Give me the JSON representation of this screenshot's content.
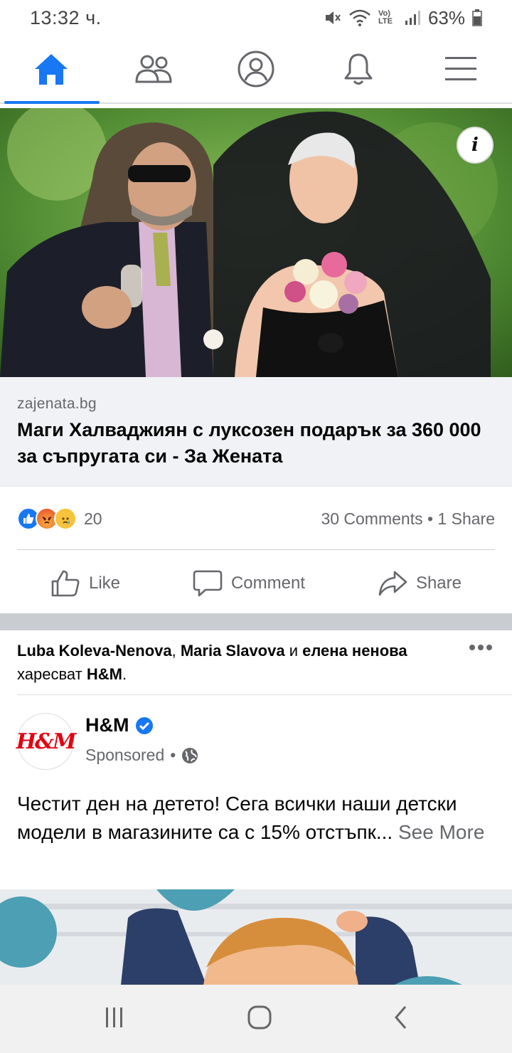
{
  "status_bar": {
    "time": "13:32 ч.",
    "network_label": "Vo) LTE",
    "battery": "63%"
  },
  "nav": {
    "tabs": [
      {
        "icon": "home-icon",
        "active": true
      },
      {
        "icon": "friends-icon",
        "active": false
      },
      {
        "icon": "profile-icon",
        "active": false
      },
      {
        "icon": "notifications-icon",
        "active": false
      },
      {
        "icon": "menu-icon",
        "active": false
      }
    ],
    "accent_color": "#1877f2"
  },
  "post1": {
    "image_icon": "info-icon",
    "info_label": "i",
    "link": {
      "domain": "zajenata.bg",
      "title": "Маги Халваджиян с луксозен подарък за 360 000 за съпругата си - За Жената"
    },
    "reactions": {
      "icons": [
        "like-reaction-icon",
        "angry-reaction-icon",
        "sad-reaction-icon"
      ],
      "count": "20"
    },
    "comments_share": "30 Comments • 1 Share",
    "actions": {
      "like": "Like",
      "comment": "Comment",
      "share": "Share"
    }
  },
  "post2": {
    "social_context": {
      "name1": "Luba Koleva-Nenova",
      "sep1": ", ",
      "name2": "Maria Slavova",
      "sep2": " и ",
      "name3": "елена ненова",
      "suffix": " харесват ",
      "page": "H&M",
      "end": "."
    },
    "page_name": "H&M",
    "avatar_text": "H&M",
    "sponsored_label": "Sponsored",
    "meta_separator": "•",
    "verified_icon": "verified-badge-icon",
    "privacy_icon": "globe-icon",
    "body_text": "Честит ден на детето! Сега всички наши детски модели в магазините са с 15% отстъпк...",
    "see_more": "See More"
  },
  "android_nav": {
    "icons": [
      "recent-apps-icon",
      "home-circle-icon",
      "back-icon"
    ]
  }
}
